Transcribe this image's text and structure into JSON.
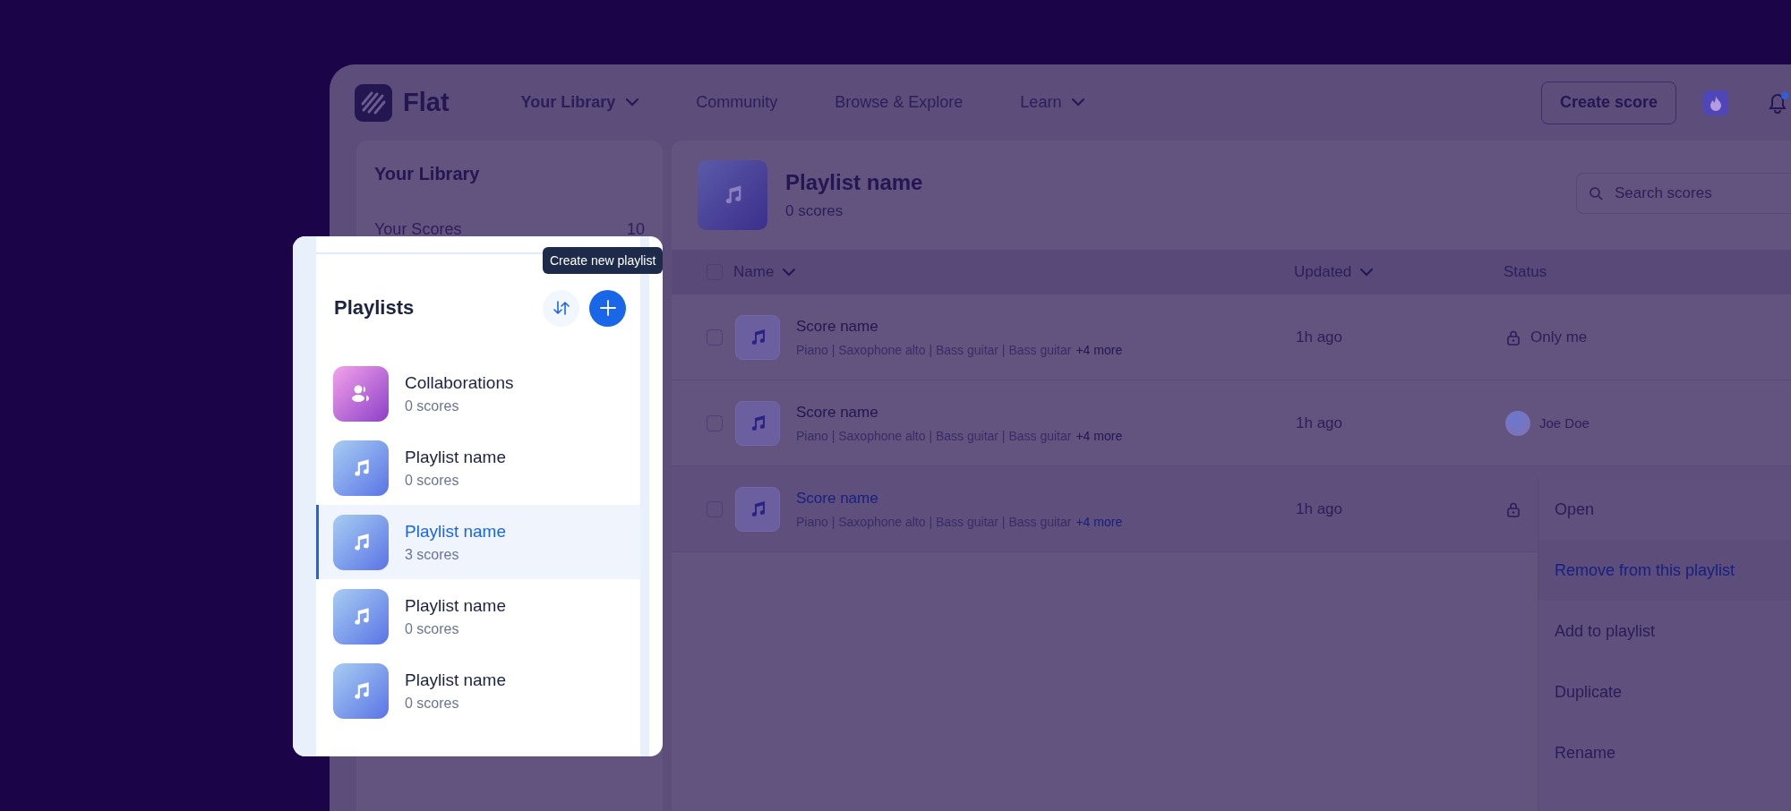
{
  "nav": {
    "logo": "Flat",
    "items": [
      {
        "label": "Your Library",
        "dropdown": true,
        "selected": true
      },
      {
        "label": "Community",
        "dropdown": false,
        "selected": false
      },
      {
        "label": "Browse & Explore",
        "dropdown": false,
        "selected": false
      },
      {
        "label": "Learn",
        "dropdown": true,
        "selected": false
      }
    ],
    "create_button": "Create score",
    "notification": true
  },
  "select_all": {
    "checked": false
  },
  "sidebar": {
    "title": "Your Library",
    "items": [
      {
        "label": "Your Scores",
        "count": "10"
      }
    ]
  },
  "playlist_header": {
    "title": "Playlist name",
    "count": "0 scores",
    "search_placeholder": "Search scores"
  },
  "table": {
    "columns": [
      {
        "label": "Name",
        "sortable": true
      },
      {
        "label": "Updated",
        "sortable": true
      },
      {
        "label": "Status",
        "sortable": false
      }
    ],
    "rows": [
      {
        "title": "Score name",
        "instruments": "Piano | Saxophone alto | Bass guitar | Bass guitar",
        "more": "+4 more",
        "updated": "1h ago",
        "kind": "private",
        "status": "Only me",
        "highlighted": false,
        "checked": false
      },
      {
        "title": "Score name",
        "instruments": "Piano | Saxophone alto | Bass guitar | Bass guitar",
        "more": "+4 more",
        "updated": "1h ago",
        "kind": "shared",
        "status": "Joe Doe",
        "highlighted": false,
        "checked": false
      },
      {
        "title": "Score name",
        "instruments": "Piano | Saxophone alto | Bass guitar | Bass guitar",
        "more": "+4 more",
        "updated": "1h ago",
        "kind": "private",
        "highlighted": true,
        "checked": false
      }
    ]
  },
  "context_menu": {
    "items": [
      {
        "label": "Open",
        "selected": false
      },
      {
        "label": "Remove from this playlist",
        "selected": true
      },
      {
        "label": "Add to playlist",
        "selected": false
      },
      {
        "label": "Duplicate",
        "selected": false
      },
      {
        "label": "Rename",
        "selected": false
      }
    ]
  },
  "playlists_panel": {
    "title": "Playlists",
    "tooltip": "Create new playlist",
    "items": [
      {
        "kind": "collaborations",
        "name": "Collaborations",
        "count": "0 scores",
        "selected": false
      },
      {
        "kind": "playlist",
        "name": "Playlist name",
        "count": "0 scores",
        "selected": false
      },
      {
        "kind": "playlist",
        "name": "Playlist name",
        "count": "3 scores",
        "selected": true
      },
      {
        "kind": "playlist",
        "name": "Playlist name",
        "count": "0 scores",
        "selected": false
      },
      {
        "kind": "playlist",
        "name": "Playlist name",
        "count": "0 scores",
        "selected": false
      }
    ]
  }
}
